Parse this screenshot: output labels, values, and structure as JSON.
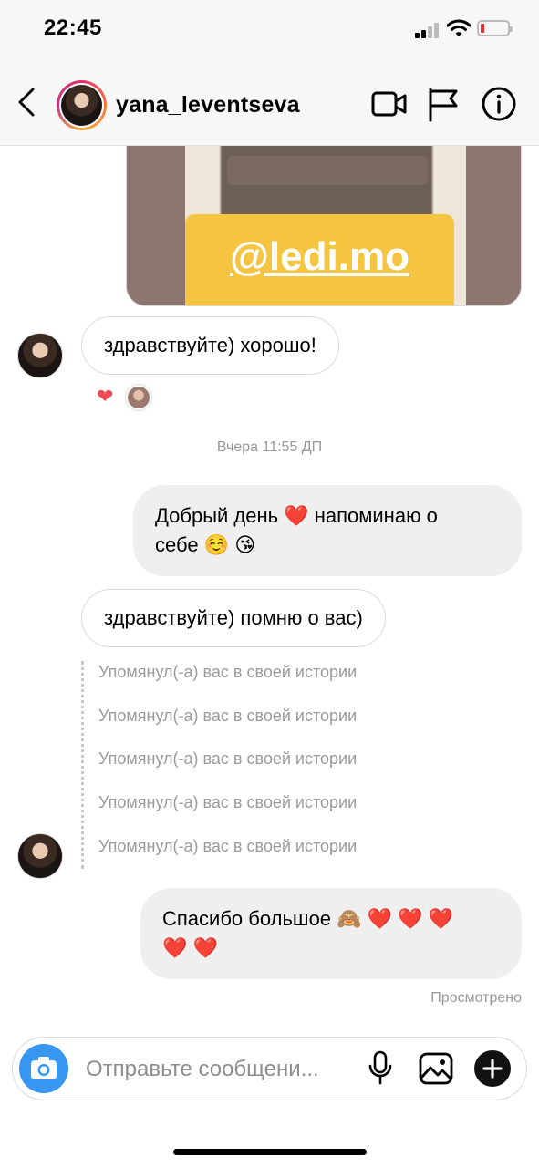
{
  "status_bar": {
    "time": "22:45",
    "icons": [
      "signal-icon",
      "wifi-icon",
      "battery-low-icon"
    ],
    "battery_color": "#e0302f"
  },
  "header": {
    "username": "yana_leventseva",
    "icons": [
      "back-chevron-icon",
      "video-call-icon",
      "flag-icon",
      "info-icon"
    ]
  },
  "story": {
    "mention_tag": "@ledi.mo",
    "tag_color": "#f5c542"
  },
  "messages": [
    {
      "from": "them",
      "text": "здравствуйте) хорошо!",
      "reactions": [
        "heart"
      ]
    },
    {
      "type": "timestamp",
      "text": "Вчера 11:55 ДП"
    },
    {
      "from": "me",
      "text_line1": "Добрый день ❤️ напоминаю о",
      "text_line2": "себе ☺️ 😘"
    },
    {
      "from": "them",
      "text": "здравствуйте) помню о вас)"
    },
    {
      "from": "them",
      "type": "story_mention",
      "text": "Упомянул(-а) вас в своей истории"
    },
    {
      "from": "them",
      "type": "story_mention",
      "text": "Упомянул(-а) вас в своей истории"
    },
    {
      "from": "them",
      "type": "story_mention",
      "text": "Упомянул(-а) вас в своей истории"
    },
    {
      "from": "them",
      "type": "story_mention",
      "text": "Упомянул(-а) вас в своей истории"
    },
    {
      "from": "them",
      "type": "story_mention",
      "text": "Упомянул(-а) вас в своей истории"
    },
    {
      "from": "me",
      "text_line1": "Спасибо большое 🙈 ❤️ ❤️ ❤️",
      "text_line2": "❤️ ❤️"
    }
  ],
  "seen_label": "Просмотрено",
  "composer": {
    "placeholder": "Отправьте сообщени...",
    "icons": [
      "camera-icon",
      "microphone-icon",
      "gallery-icon",
      "plus-icon"
    ],
    "camera_color": "#3897f0"
  }
}
